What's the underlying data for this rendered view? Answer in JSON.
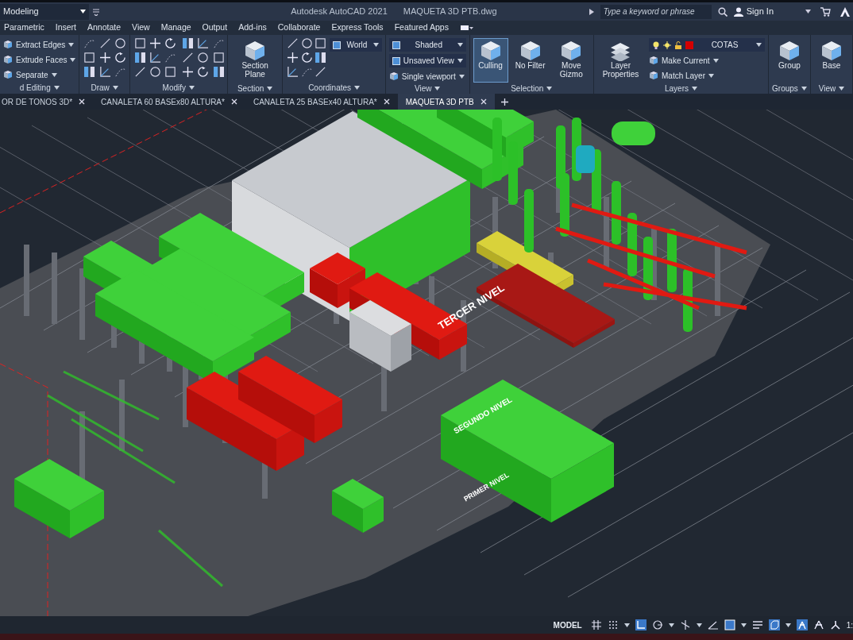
{
  "title_bar": {
    "workspace": "Modeling",
    "app_title": "Autodesk AutoCAD 2021",
    "file_name": "MAQUETA 3D PTB.dwg",
    "search": {
      "placeholder": "Type a keyword or phrase"
    },
    "sign_in": "Sign In"
  },
  "ribbon_tabs": [
    "Parametric",
    "Insert",
    "Annotate",
    "View",
    "Manage",
    "Output",
    "Add-ins",
    "Collaborate",
    "Express Tools",
    "Featured Apps"
  ],
  "ribbon_panels": [
    {
      "title": "d Editing",
      "columns": [
        [
          {
            "kind": "small_button",
            "label": "Extract Edges"
          },
          {
            "kind": "small_button",
            "label": "Extrude Faces"
          },
          {
            "kind": "small_button",
            "label": "Separate"
          }
        ]
      ]
    },
    {
      "title": "Draw",
      "columns": [
        [
          {
            "kind": "icon_grid"
          }
        ]
      ]
    },
    {
      "title": "Modify",
      "columns": [
        [
          {
            "kind": "icon_grid"
          }
        ],
        [
          {
            "kind": "icon_grid"
          }
        ]
      ]
    },
    {
      "title": "Section",
      "columns": [
        [
          {
            "kind": "large_button",
            "label": "Section Plane",
            "selected": false
          }
        ]
      ]
    },
    {
      "title": "Coordinates",
      "columns": [
        [
          {
            "kind": "icon_grid"
          }
        ],
        [
          {
            "kind": "dropdown",
            "value": "World"
          }
        ]
      ]
    },
    {
      "title": "View",
      "columns": [
        [
          {
            "kind": "dropdown",
            "value": "Shaded"
          },
          {
            "kind": "dropdown",
            "value": "Unsaved View"
          },
          {
            "kind": "small_button",
            "label": "Single viewport"
          }
        ]
      ]
    },
    {
      "title": "Selection",
      "columns": [
        [
          {
            "kind": "large_button",
            "label": "Culling",
            "selected": true
          }
        ],
        [
          {
            "kind": "large_button",
            "label": "No Filter",
            "selected": false
          }
        ],
        [
          {
            "kind": "large_button",
            "label": "Move Gizmo",
            "selected": false
          }
        ]
      ]
    },
    {
      "title": "Layers",
      "columns": [
        [
          {
            "kind": "large_button",
            "label": "Layer Properties",
            "selected": false
          }
        ],
        [
          {
            "kind": "dropdown",
            "value": "COTAS",
            "color": "#d40000"
          },
          {
            "kind": "small_button",
            "label": "Make Current"
          },
          {
            "kind": "small_button",
            "label": "Match Layer"
          }
        ]
      ]
    },
    {
      "title": "Groups",
      "columns": [
        [
          {
            "kind": "large_button",
            "label": "Group",
            "selected": false
          }
        ]
      ]
    },
    {
      "title": "View",
      "columns": [
        [
          {
            "kind": "large_button",
            "label": "Base",
            "selected": false
          }
        ]
      ]
    }
  ],
  "file_tabs": [
    {
      "label": "OR DE TONOS 3D*",
      "selected": false
    },
    {
      "label": "CANALETA 60 BASEx80 ALTURA*",
      "selected": false
    },
    {
      "label": "CANALETA 25 BASEx40 ALTURA*",
      "selected": false
    },
    {
      "label": "MAQUETA 3D PTB",
      "selected": true
    }
  ],
  "viewport": {
    "labels": [
      "TERCER NIVEL",
      "SEGUNDO NIVEL",
      "PRIMER NIVEL"
    ]
  },
  "status_bar": {
    "mode": "MODEL",
    "scale": "1:"
  }
}
